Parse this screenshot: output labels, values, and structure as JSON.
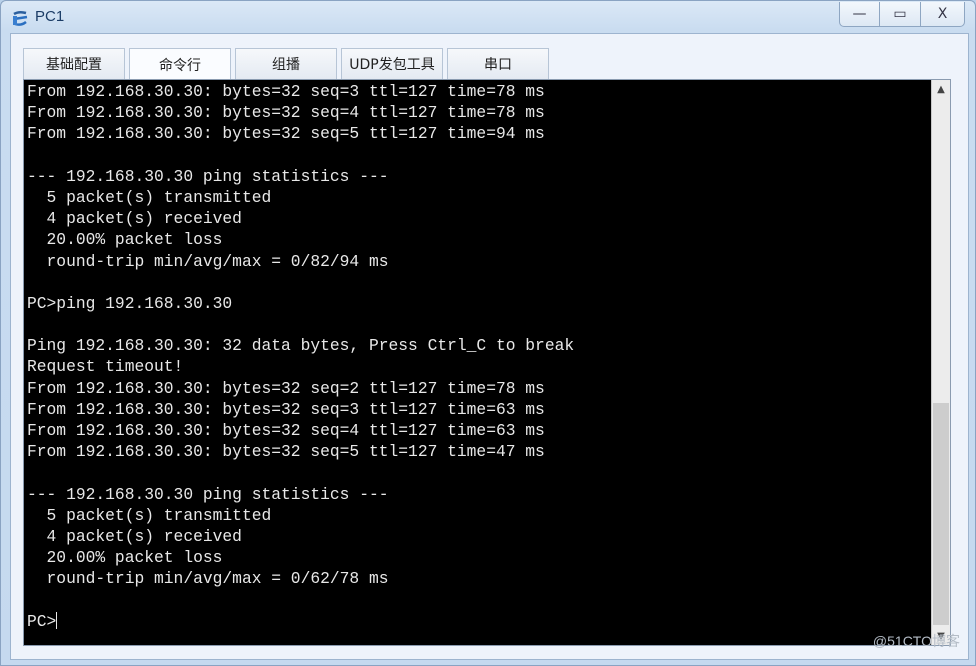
{
  "window": {
    "title": "PC1",
    "controls": {
      "minimize": "—",
      "maximize": "▭",
      "close": "X"
    }
  },
  "tabs": [
    {
      "label": "基础配置",
      "active": false
    },
    {
      "label": "命令行",
      "active": true
    },
    {
      "label": "组播",
      "active": false
    },
    {
      "label": "UDP发包工具",
      "active": false
    },
    {
      "label": "串口",
      "active": false
    }
  ],
  "terminal": {
    "lines": [
      "From 192.168.30.30: bytes=32 seq=3 ttl=127 time=78 ms",
      "From 192.168.30.30: bytes=32 seq=4 ttl=127 time=78 ms",
      "From 192.168.30.30: bytes=32 seq=5 ttl=127 time=94 ms",
      "",
      "--- 192.168.30.30 ping statistics ---",
      "  5 packet(s) transmitted",
      "  4 packet(s) received",
      "  20.00% packet loss",
      "  round-trip min/avg/max = 0/82/94 ms",
      "",
      "PC>ping 192.168.30.30",
      "",
      "Ping 192.168.30.30: 32 data bytes, Press Ctrl_C to break",
      "Request timeout!",
      "From 192.168.30.30: bytes=32 seq=2 ttl=127 time=78 ms",
      "From 192.168.30.30: bytes=32 seq=3 ttl=127 time=63 ms",
      "From 192.168.30.30: bytes=32 seq=4 ttl=127 time=63 ms",
      "From 192.168.30.30: bytes=32 seq=5 ttl=127 time=47 ms",
      "",
      "--- 192.168.30.30 ping statistics ---",
      "  5 packet(s) transmitted",
      "  4 packet(s) received",
      "  20.00% packet loss",
      "  round-trip min/avg/max = 0/62/78 ms",
      ""
    ],
    "prompt": "PC>",
    "scroll_position": 1.0
  },
  "watermark": "@51CTO博客"
}
